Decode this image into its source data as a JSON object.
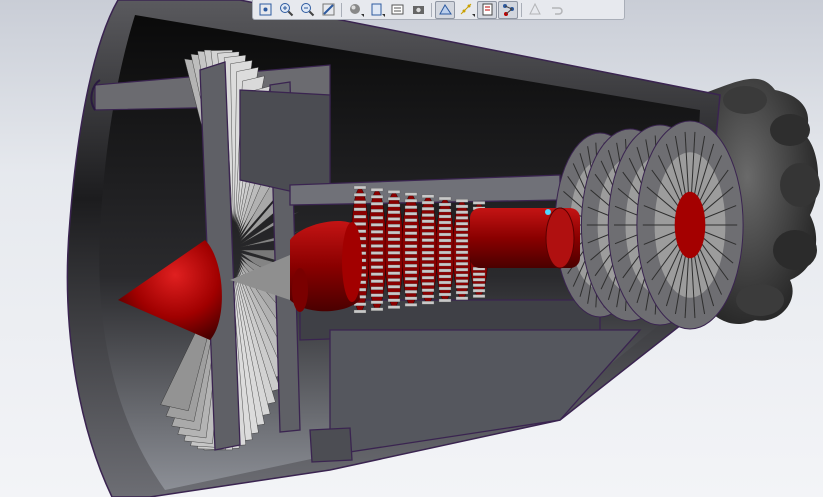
{
  "viewer": {
    "background_top": "#c9cdd6",
    "background_bottom": "#f3f4f7",
    "model": {
      "subject": "turbofan-engine-cutaway",
      "accent_color": "#b00000",
      "metal_color": "#9a9a9a",
      "edge_color": "#4a2a6a"
    }
  },
  "toolbar": {
    "buttons": [
      {
        "icon": "refit-icon",
        "active": false
      },
      {
        "icon": "zoom-in-icon",
        "active": false
      },
      {
        "icon": "zoom-out-icon",
        "active": false
      },
      {
        "icon": "view-normal-icon",
        "active": false
      },
      {
        "icon": "display-style-icon",
        "active": false,
        "dropdown": true
      },
      {
        "icon": "saved-views-icon",
        "active": false,
        "dropdown": true
      },
      {
        "icon": "view-manager-icon",
        "active": false
      },
      {
        "icon": "snapshot-icon",
        "active": false
      },
      {
        "icon": "perspective-icon",
        "active": true
      },
      {
        "icon": "datum-display-icon",
        "active": false,
        "dropdown": true
      },
      {
        "icon": "annotation-display-icon",
        "active": true
      },
      {
        "icon": "spin-center-icon",
        "active": true
      },
      {
        "icon": "regenerate-icon",
        "active": false,
        "disabled": true
      },
      {
        "icon": "undo-icon",
        "active": false,
        "disabled": true
      }
    ]
  }
}
